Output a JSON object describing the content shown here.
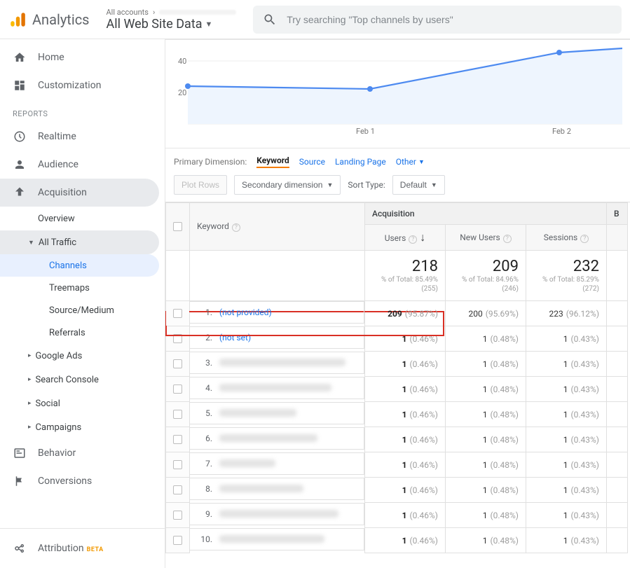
{
  "header": {
    "product": "Analytics",
    "crumb_prefix": "All accounts",
    "view_name": "All Web Site Data",
    "search_placeholder": "Try searching \"Top channels by users\""
  },
  "sidebar": {
    "home": "Home",
    "customization": "Customization",
    "reports_label": "REPORTS",
    "realtime": "Realtime",
    "audience": "Audience",
    "acquisition": "Acquisition",
    "acq_overview": "Overview",
    "acq_all_traffic": "All Traffic",
    "channels": "Channels",
    "treemaps": "Treemaps",
    "source_medium": "Source/Medium",
    "referrals": "Referrals",
    "google_ads": "Google Ads",
    "search_console": "Search Console",
    "social": "Social",
    "campaigns": "Campaigns",
    "behavior": "Behavior",
    "conversions": "Conversions",
    "attribution": "Attribution",
    "beta": "BETA"
  },
  "chart_data": {
    "type": "line",
    "x_labels": [
      "",
      "Feb 1",
      "Feb 2",
      ""
    ],
    "y_ticks": [
      20,
      40
    ],
    "series": [
      {
        "name": "Users",
        "values": [
          24,
          24,
          48,
          51
        ]
      }
    ]
  },
  "dimensions": {
    "label": "Primary Dimension:",
    "active": "Keyword",
    "source": "Source",
    "landing": "Landing Page",
    "other": "Other"
  },
  "controls": {
    "plot_rows": "Plot Rows",
    "secondary": "Secondary dimension",
    "sort_label": "Sort Type:",
    "sort_value": "Default"
  },
  "table": {
    "kw_header": "Keyword",
    "group_header": "Acquisition",
    "behavior_header": "B",
    "col_users": "Users",
    "col_new_users": "New Users",
    "col_sessions": "Sessions",
    "totals": {
      "users": {
        "v": "218",
        "sub": "% of Total: 85.49% (255)"
      },
      "new_users": {
        "v": "209",
        "sub": "% of Total: 84.96% (246)"
      },
      "sessions": {
        "v": "232",
        "sub": "% of Total: 85.29% (272)"
      }
    },
    "rows": [
      {
        "rank": "1.",
        "kw": "(not provided)",
        "link": true,
        "users": "209",
        "users_pct": "(95.87%)",
        "new": "200",
        "new_pct": "(95.69%)",
        "sess": "223",
        "sess_pct": "(96.12%)",
        "hl": true
      },
      {
        "rank": "2.",
        "kw": "(not set)",
        "link": true,
        "users": "1",
        "users_pct": "(0.46%)",
        "new": "1",
        "new_pct": "(0.48%)",
        "sess": "1",
        "sess_pct": "(0.43%)"
      },
      {
        "rank": "3.",
        "kw": "",
        "redact": 180,
        "users": "1",
        "users_pct": "(0.46%)",
        "new": "1",
        "new_pct": "(0.48%)",
        "sess": "1",
        "sess_pct": "(0.43%)"
      },
      {
        "rank": "4.",
        "kw": "",
        "redact": 160,
        "users": "1",
        "users_pct": "(0.46%)",
        "new": "1",
        "new_pct": "(0.48%)",
        "sess": "1",
        "sess_pct": "(0.43%)"
      },
      {
        "rank": "5.",
        "kw": "",
        "redact": 110,
        "users": "1",
        "users_pct": "(0.46%)",
        "new": "1",
        "new_pct": "(0.48%)",
        "sess": "1",
        "sess_pct": "(0.43%)"
      },
      {
        "rank": "6.",
        "kw": "",
        "redact": 140,
        "users": "1",
        "users_pct": "(0.46%)",
        "new": "1",
        "new_pct": "(0.48%)",
        "sess": "1",
        "sess_pct": "(0.43%)"
      },
      {
        "rank": "7.",
        "kw": "",
        "redact": 80,
        "users": "1",
        "users_pct": "(0.46%)",
        "new": "1",
        "new_pct": "(0.48%)",
        "sess": "1",
        "sess_pct": "(0.43%)"
      },
      {
        "rank": "8.",
        "kw": "",
        "redact": 120,
        "users": "1",
        "users_pct": "(0.46%)",
        "new": "1",
        "new_pct": "(0.48%)",
        "sess": "1",
        "sess_pct": "(0.43%)"
      },
      {
        "rank": "9.",
        "kw": "",
        "redact": 170,
        "users": "1",
        "users_pct": "(0.46%)",
        "new": "1",
        "new_pct": "(0.48%)",
        "sess": "1",
        "sess_pct": "(0.43%)"
      },
      {
        "rank": "10.",
        "kw": "",
        "redact": 150,
        "users": "1",
        "users_pct": "(0.46%)",
        "new": "1",
        "new_pct": "(0.48%)",
        "sess": "1",
        "sess_pct": "(0.43%)"
      }
    ]
  }
}
